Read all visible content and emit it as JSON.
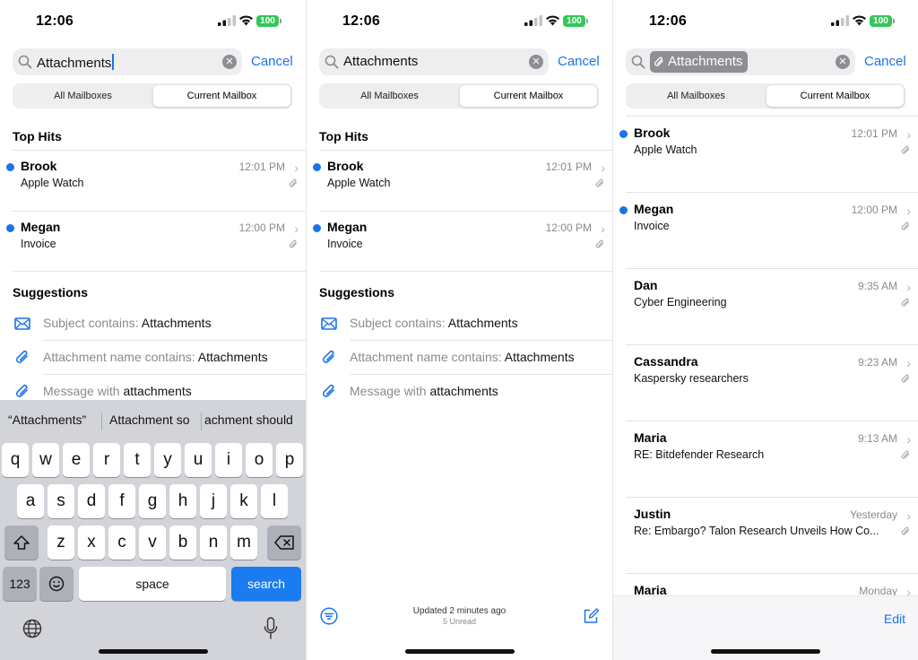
{
  "status": {
    "time": "12:06",
    "battery": "100"
  },
  "search": {
    "query": "Attachments",
    "cancel_label": "Cancel"
  },
  "scope": {
    "all": "All Mailboxes",
    "current": "Current Mailbox",
    "selected": "current"
  },
  "sections": {
    "top_hits": "Top Hits",
    "suggestions": "Suggestions"
  },
  "top_hits": [
    {
      "sender": "Brook",
      "subject": "Apple Watch",
      "time": "12:01 PM",
      "unread": true,
      "attachment": true
    },
    {
      "sender": "Megan",
      "subject": "Invoice",
      "time": "12:00 PM",
      "unread": true,
      "attachment": true
    }
  ],
  "suggestions": [
    {
      "icon": "envelope-icon",
      "prefix": "Subject contains: ",
      "term": "Attachments"
    },
    {
      "icon": "paperclip-icon",
      "prefix": "Attachment name contains: ",
      "term": "Attachments"
    },
    {
      "icon": "paperclip-icon",
      "prefix": "Message with ",
      "term": "attachments"
    }
  ],
  "keyboard": {
    "predictions": [
      "“Attachments”",
      "Attachment so",
      "achment should"
    ],
    "row1": [
      "q",
      "w",
      "e",
      "r",
      "t",
      "y",
      "u",
      "i",
      "o",
      "p"
    ],
    "row2": [
      "a",
      "s",
      "d",
      "f",
      "g",
      "h",
      "j",
      "k",
      "l"
    ],
    "row3": [
      "z",
      "x",
      "c",
      "v",
      "b",
      "n",
      "m"
    ],
    "numbers_label": "123",
    "space_label": "space",
    "search_label": "search"
  },
  "footer": {
    "updated": "Updated 2 minutes ago",
    "unread": "5 Unread",
    "edit_label": "Edit"
  },
  "results": [
    {
      "sender": "Brook",
      "subject": "Apple Watch",
      "time": "12:01 PM",
      "unread": true,
      "attachment": true
    },
    {
      "sender": "Megan",
      "subject": "Invoice",
      "time": "12:00 PM",
      "unread": true,
      "attachment": true
    },
    {
      "sender": "Dan",
      "subject": "Cyber Engineering",
      "time": "9:35 AM",
      "unread": false,
      "attachment": true
    },
    {
      "sender": "Cassandra",
      "subject": "Kaspersky researchers",
      "time": "9:23 AM",
      "unread": false,
      "attachment": true
    },
    {
      "sender": "Maria",
      "subject": "RE: Bitdefender Research",
      "time": "9:13 AM",
      "unread": false,
      "attachment": true
    },
    {
      "sender": "Justin",
      "subject": "Re: Embargo? Talon Research Unveils How Co...",
      "time": "Yesterday",
      "unread": false,
      "attachment": true
    },
    {
      "sender": "Maria",
      "subject": "",
      "time": "Monday",
      "unread": false,
      "attachment": false
    }
  ],
  "colors": {
    "accent": "#1a73e8",
    "battery": "#34c759",
    "search_key": "#1a7cf0"
  }
}
